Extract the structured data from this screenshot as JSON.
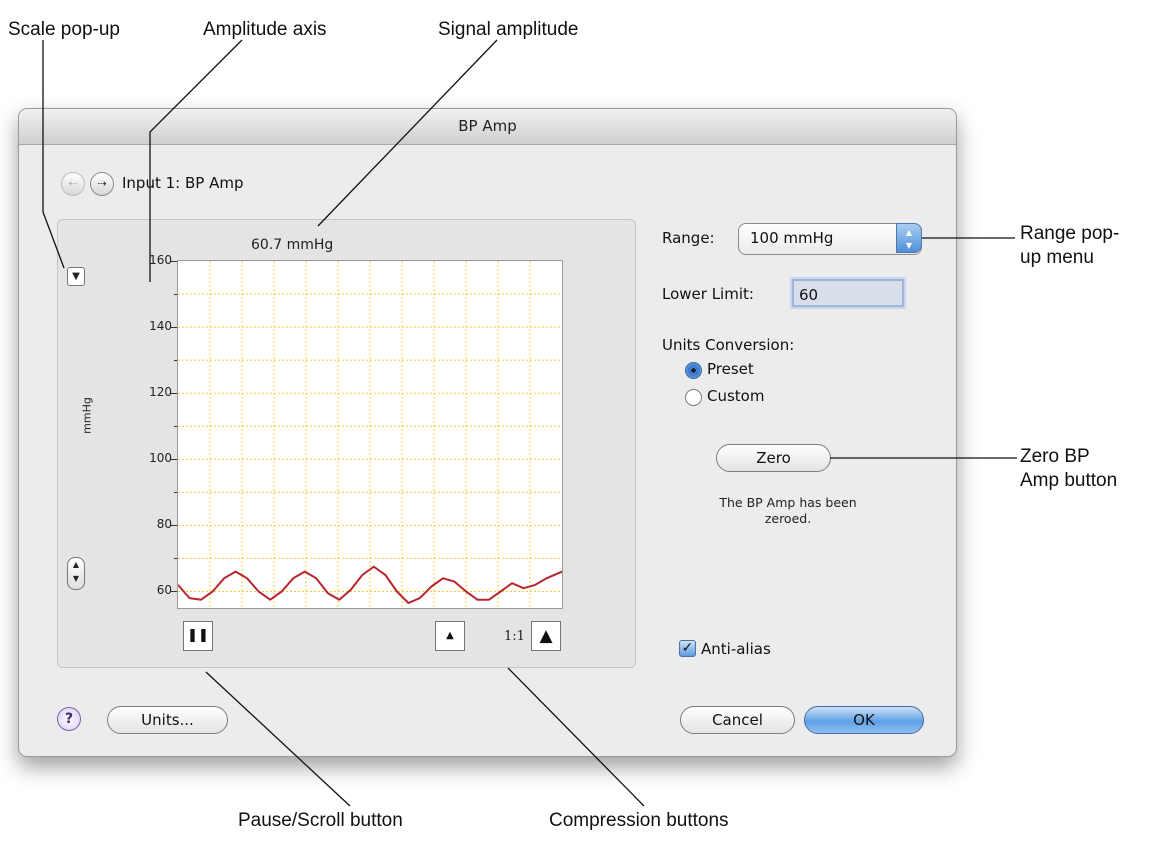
{
  "callouts": {
    "scale_popup": "Scale pop-up",
    "amplitude_axis": "Amplitude axis",
    "signal_amplitude": "Signal amplitude",
    "range_popup_line1": "Range pop-",
    "range_popup_line2": "up menu",
    "zero_button_line1": "Zero BP",
    "zero_button_line2": "Amp button",
    "pause_scroll": "Pause/Scroll button",
    "compression": "Compression buttons"
  },
  "window": {
    "title": "BP Amp",
    "input_title": "Input 1: BP Amp"
  },
  "chart": {
    "readout": "60.7 mmHg",
    "unit_label": "mmHg",
    "ratio": "1:1"
  },
  "settings": {
    "range_label": "Range:",
    "range_value": "100 mmHg",
    "lower_limit_label": "Lower Limit:",
    "lower_limit_value": "60",
    "units_conversion_label": "Units Conversion:",
    "preset_label": "Preset",
    "custom_label": "Custom",
    "zero_button": "Zero",
    "status_line1": "The BP Amp has been",
    "status_line2": "zeroed.",
    "antialias_label": "Anti-alias"
  },
  "footer": {
    "help": "?",
    "units_button": "Units...",
    "cancel_button": "Cancel",
    "ok_button": "OK"
  },
  "colors": {
    "trace": "#b8262e",
    "grid": "#f0cc3c",
    "ok_accent": "#5ea0e6"
  },
  "chart_data": {
    "type": "line",
    "title": "",
    "xlabel": "",
    "ylabel": "mmHg",
    "yticks": [
      160,
      140,
      120,
      100,
      80,
      60
    ],
    "ylim": [
      55,
      160
    ],
    "xlim": [
      0,
      100
    ],
    "grid": true,
    "series": [
      {
        "x": [
          0,
          3,
          6,
          9,
          12,
          15,
          18,
          21,
          24,
          27,
          30,
          33,
          36,
          39,
          42,
          45,
          48,
          51,
          54,
          57,
          60,
          63,
          66,
          69,
          72,
          75,
          78,
          81,
          84,
          87,
          90,
          93,
          96,
          100
        ],
        "values": [
          62,
          58,
          57.5,
          60,
          64,
          66,
          64,
          60,
          57.5,
          60,
          64,
          66,
          64,
          59.5,
          57.5,
          60.5,
          65,
          67.5,
          65,
          60,
          56.5,
          58,
          61.5,
          64,
          63,
          60,
          57.5,
          57.5,
          60,
          62.5,
          61,
          62,
          64,
          66
        ]
      }
    ]
  }
}
